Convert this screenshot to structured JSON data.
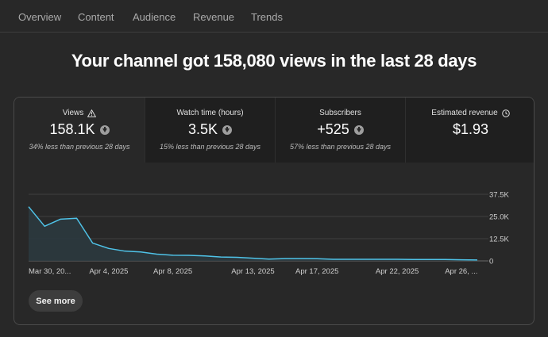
{
  "tabs": [
    {
      "label": "Overview",
      "active": true
    },
    {
      "label": "Content",
      "active": false
    },
    {
      "label": "Audience",
      "active": false
    },
    {
      "label": "Revenue",
      "active": false
    },
    {
      "label": "Trends",
      "active": false
    }
  ],
  "headline": "Your channel got 158,080 views in the last 28 days",
  "metrics": [
    {
      "label": "Views",
      "value": "158.1K",
      "sub": "34% less than previous 28 days",
      "icon": "warning-icon",
      "trend_icon": "down-arrow-icon"
    },
    {
      "label": "Watch time (hours)",
      "value": "3.5K",
      "sub": "15% less than previous 28 days",
      "trend_icon": "down-arrow-icon"
    },
    {
      "label": "Subscribers",
      "value": "+525",
      "sub": "57% less than previous 28 days",
      "trend_icon": "down-arrow-icon"
    },
    {
      "label": "Estimated revenue",
      "value": "$1.93",
      "icon": "clock-icon"
    }
  ],
  "see_more_label": "See more",
  "colors": {
    "line": "#4fc3e8",
    "background": "#282828",
    "metric_bg": "#1f1f1f"
  },
  "chart_data": {
    "type": "area",
    "x": [
      "Mar 30",
      "Mar 31",
      "Apr 1",
      "Apr 2",
      "Apr 3",
      "Apr 4",
      "Apr 5",
      "Apr 6",
      "Apr 7",
      "Apr 8",
      "Apr 9",
      "Apr 10",
      "Apr 11",
      "Apr 12",
      "Apr 13",
      "Apr 14",
      "Apr 15",
      "Apr 16",
      "Apr 17",
      "Apr 18",
      "Apr 19",
      "Apr 20",
      "Apr 21",
      "Apr 22",
      "Apr 23",
      "Apr 24",
      "Apr 25",
      "Apr 26",
      "Apr 27"
    ],
    "tick_labels": [
      "Mar 30, 20...",
      "Apr 4, 2025",
      "Apr 8, 2025",
      "Apr 13, 2025",
      "Apr 17, 2025",
      "Apr 22, 2025",
      "Apr 26, ..."
    ],
    "tick_indices": [
      0,
      5,
      9,
      14,
      18,
      23,
      27
    ],
    "series": [
      {
        "values": [
          30500,
          19500,
          23500,
          24000,
          10000,
          7000,
          5500,
          5000,
          3800,
          3200,
          3100,
          2800,
          2200,
          2000,
          1500,
          1000,
          1300,
          1300,
          1200,
          900,
          900,
          900,
          900,
          900,
          800,
          800,
          800,
          600,
          500
        ]
      }
    ],
    "yticks": [
      0,
      12500,
      25000,
      37500
    ],
    "ytick_labels": [
      "0",
      "12.5K",
      "25.0K",
      "37.5K"
    ],
    "ylim": [
      0,
      37500
    ],
    "grid": true
  }
}
